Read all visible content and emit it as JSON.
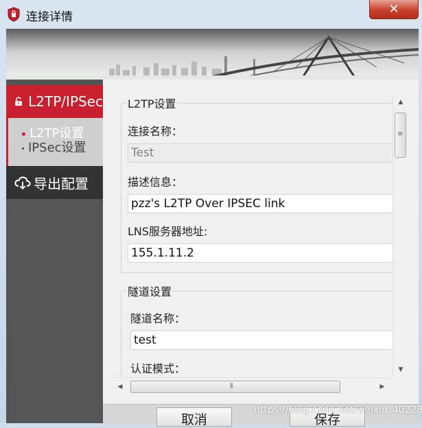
{
  "window": {
    "title": "连接详情",
    "close_label": "✕"
  },
  "sidebar": {
    "active_item": {
      "label": "L2TP/IPSec",
      "icon": "lock-icon"
    },
    "sub_items": [
      {
        "label": "L2TP设置"
      },
      {
        "label": "IPSec设置"
      }
    ],
    "export_item": {
      "label": "导出配置",
      "icon": "cloud-download-icon"
    }
  },
  "l2tp_group": {
    "legend": "L2TP设置",
    "connection_name_label": "连接名称：",
    "connection_name_value": "Test",
    "description_label": "描述信息：",
    "description_value": "pzz's L2TP Over IPSEC link",
    "lns_label": "LNS服务器地址:",
    "lns_value": "155.1.11.2"
  },
  "tunnel_group": {
    "legend": "隧道设置",
    "tunnel_name_label": "隧道名称：",
    "tunnel_name_value": "test",
    "auth_mode_label": "认证模式："
  },
  "buttons": {
    "cancel": "取消",
    "save": "保存"
  },
  "watermark": "https://blog.csdn.net/weixin_40228200",
  "colors": {
    "accent_red": "#c8202e",
    "sidebar_dark": "#555555"
  }
}
